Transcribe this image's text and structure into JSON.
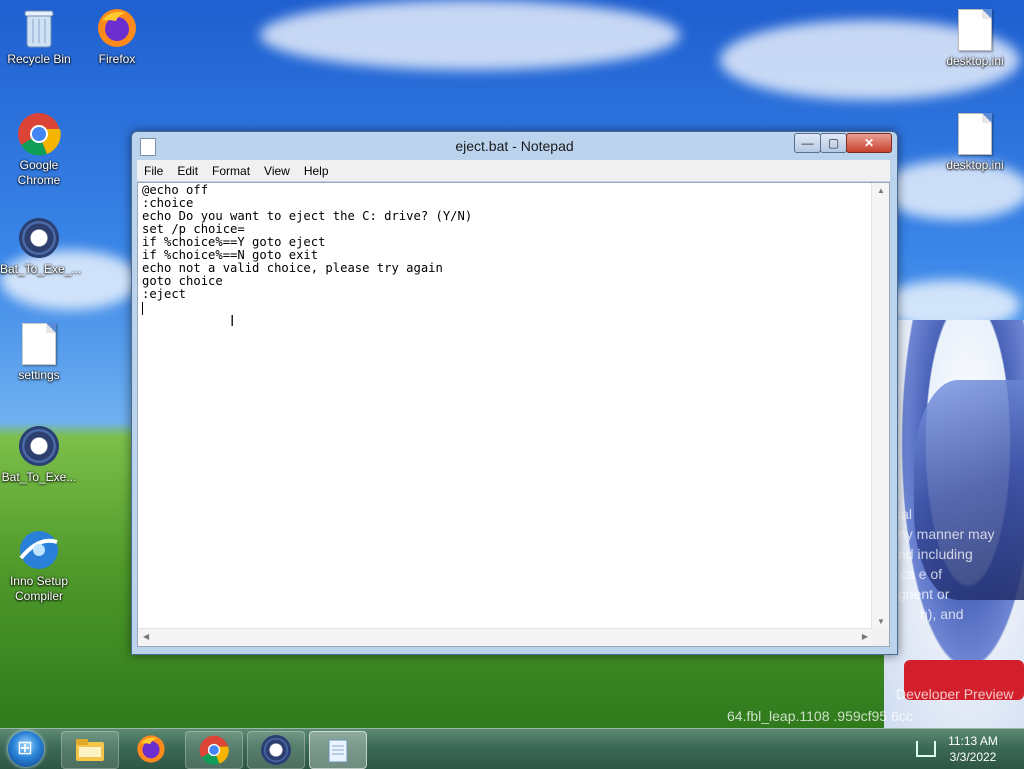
{
  "desktop": {
    "icons_left": [
      {
        "label": "Recycle Bin",
        "icon": "recycle-bin-icon"
      },
      {
        "label": "Firefox",
        "icon": "firefox-icon"
      },
      {
        "label": "Google Chrome",
        "icon": "chrome-icon"
      },
      {
        "label": "Bat_To_Exe_...",
        "icon": "gear-icon"
      },
      {
        "label": "settings",
        "icon": "document-icon"
      },
      {
        "label": "Bat_To_Exe...",
        "icon": "gear-icon"
      },
      {
        "label": "Inno Setup Compiler",
        "icon": "inno-setup-icon"
      }
    ],
    "icons_right": [
      {
        "label": "desktop.ini",
        "icon": "settings-file-icon"
      },
      {
        "label": "desktop.ini",
        "icon": "settings-file-icon"
      }
    ],
    "watermark": {
      "line1": "ial",
      "line2": "ny manner may",
      "line3": "nd including",
      "line4": "ca e of",
      "line5": "gnent or",
      "line6": "h), and",
      "line7": "Developer Preview",
      "line8": "64.fbl_leap.1108 .959cf95 6cc"
    }
  },
  "notepad": {
    "title": "eject.bat - Notepad",
    "menu": [
      "File",
      "Edit",
      "Format",
      "View",
      "Help"
    ],
    "content": "@echo off\n:choice\necho Do you want to eject the C: drive? (Y/N)\nset /p choice=\nif %choice%==Y goto eject\nif %choice%==N goto exit\necho not a valid choice, please try again\ngoto choice\n:eject\n",
    "buttons": {
      "minimize": "—",
      "maximize": "▢",
      "close": "✕"
    }
  },
  "taskbar": {
    "pinned": [
      {
        "name": "explorer",
        "icon": "folder-icon"
      },
      {
        "name": "firefox",
        "icon": "firefox-icon"
      },
      {
        "name": "chrome",
        "icon": "chrome-icon"
      },
      {
        "name": "bat-to-exe",
        "icon": "gear-icon"
      },
      {
        "name": "notepad",
        "icon": "notepad-icon"
      }
    ],
    "clock": {
      "time": "11:13 AM",
      "date": "3/3/2022"
    }
  },
  "colors": {
    "taskbar": "#3c6a56",
    "window_frame": "#bcd3ee",
    "close_button": "#c7402c"
  }
}
